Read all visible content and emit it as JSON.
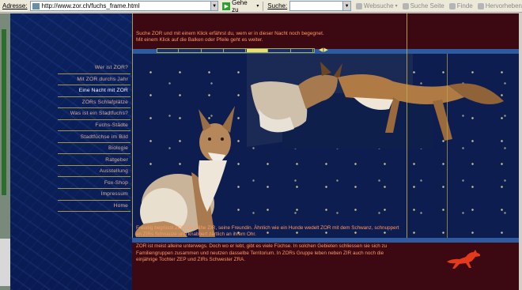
{
  "browser": {
    "address_label": "Adresse:",
    "url": "http://www.zor.ch/fuchs_frame.html",
    "go_label": "Gehe zu",
    "search_label": "Suche:",
    "websuche_label": "Websuche",
    "suche_seite_label": "Suche Seite",
    "finde_label": "Finde",
    "hervorheben_label": "Hervorheben"
  },
  "site": {
    "intro_line1": "Suche ZOR und mit einem Klick erfährst du, wem er in dieser Nacht noch begegnet.",
    "intro_line2": "Mit einem Klick auf die Balken oder Pfeile geht es weiter.",
    "slider_progress_segments": [
      0,
      0,
      0,
      0,
      1,
      0,
      0
    ],
    "nav_items": [
      {
        "label": "Wer ist ZOR?",
        "active": false
      },
      {
        "label": "Mit ZOR durchs Jahr",
        "active": false
      },
      {
        "label": "Eine Nacht mit ZOR",
        "active": true
      },
      {
        "label": "ZORs Schlafplätze",
        "active": false
      },
      {
        "label": "Was ist ein Stadtfuchs?",
        "active": false
      },
      {
        "label": "Fuchs-Städte",
        "active": false
      },
      {
        "label": "Stadtfüchse im Bild",
        "active": false
      },
      {
        "label": "Biologie",
        "active": false
      },
      {
        "label": "Ratgeber",
        "active": false
      },
      {
        "label": "Ausstellung",
        "active": false
      },
      {
        "label": "Fox-Shop",
        "active": false
      },
      {
        "label": "Impressum",
        "active": false
      },
      {
        "label": "Home",
        "active": false
      }
    ],
    "body_paragraph1": "Freudig begrüsst ZOR die Fähe ZIR, seine Freundin. Ähnlich wie ein Hunde wedelt ZOR mit dem Schwanz, schnuppert an ZIRs Schnauze und knabbert zärtlich an ihrem Ohr.",
    "body_paragraph2": "ZOR ist meist alleine unterwegs. Doch wo er lebt, gibt es viele Füchse. In solchen Gebieten schliessen sie sich zu Familiengruppen zusammen und neutzen dasselbe Territorium. In ZORs Gruppe leben neben ZIR auch noch die einjährige Tochter ZEP und ZIRs Schwester ZRA."
  },
  "colors": {
    "site_blue": "#081a50",
    "banner_red": "#3c0812",
    "text_orange": "#ff9966",
    "rule_gold": "#a39544",
    "slider_yellow": "#e8e070",
    "fox_logo_red": "#e23a1a"
  },
  "icons": {
    "favicon": "page-icon",
    "go": "green-arrow-icon",
    "logo": "running-fox-icon"
  }
}
